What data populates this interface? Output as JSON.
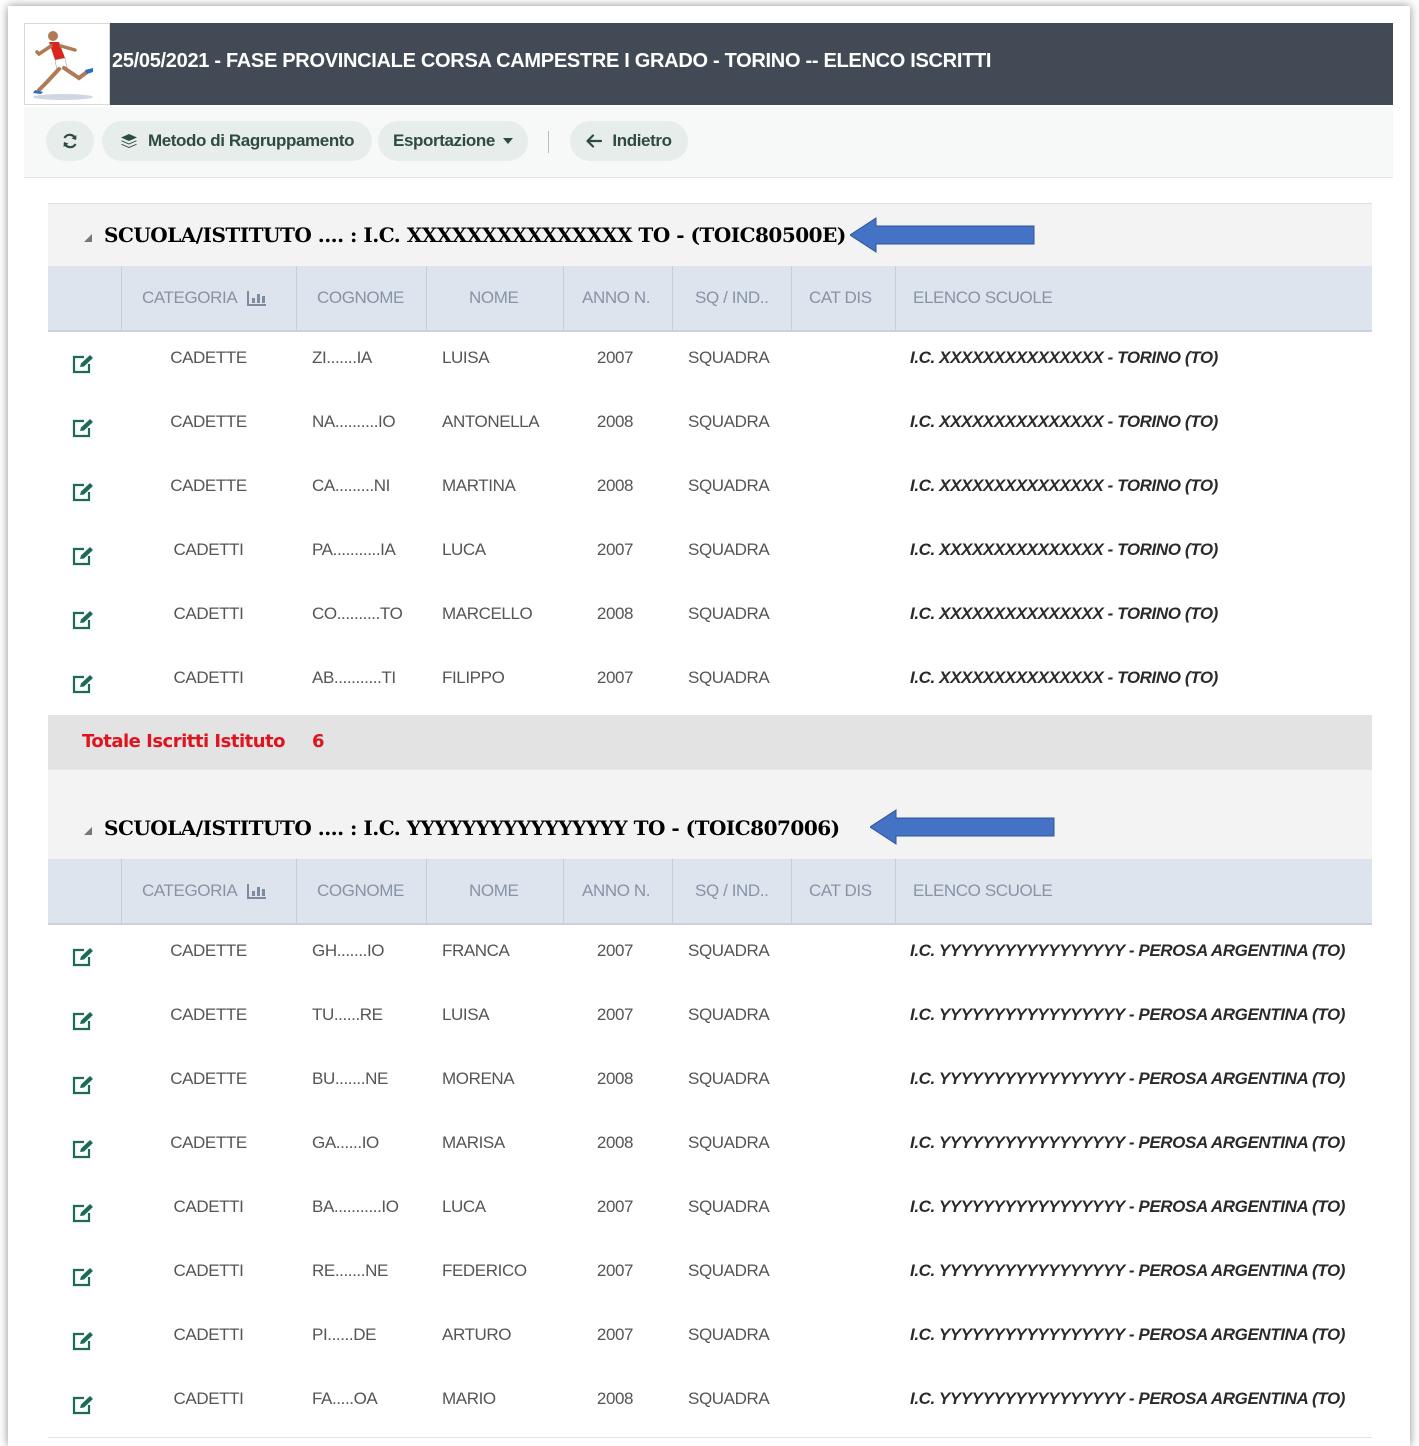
{
  "header": {
    "title": "25/05/2021 - FASE PROVINCIALE CORSA CAMPESTRE I GRADO - TORINO -- ELENCO ISCRITTI",
    "logo_icon": "runner-logo-icon"
  },
  "toolbar": {
    "refresh_icon": "refresh-icon",
    "grouping_label": "Metodo di Ragruppamento",
    "export_label": "Esportazione",
    "back_label": "Indietro"
  },
  "columns": {
    "categoria": "CATEGORIA",
    "cognome": "COGNOME",
    "nome": "NOME",
    "anno": "ANNO N.",
    "sq": "SQ / IND..",
    "catdis": "CAT DIS",
    "scuole": "ELENCO SCUOLE"
  },
  "colors": {
    "title_bar": "#424a55",
    "arrow": "#4472c4",
    "total_text": "#e0141f",
    "edit_icon": "#1c6b59"
  },
  "groups": [
    {
      "header": "SCUOLA/ISTITUTO .... : I.C. XXXXXXXXXXXXXXX TO - (TOIC80500E)",
      "rows": [
        {
          "categoria": "CADETTE",
          "cognome": "ZI.......IA",
          "nome": "LUISA",
          "anno": "2007",
          "sq": "SQUADRA",
          "catdis": "",
          "scuola": "I.C. XXXXXXXXXXXXXXX - TORINO (TO)"
        },
        {
          "categoria": "CADETTE",
          "cognome": "NA..........IO",
          "nome": "ANTONELLA",
          "anno": "2008",
          "sq": "SQUADRA",
          "catdis": "",
          "scuola": "I.C. XXXXXXXXXXXXXXX - TORINO (TO)"
        },
        {
          "categoria": "CADETTE",
          "cognome": "CA.........NI",
          "nome": "MARTINA",
          "anno": "2008",
          "sq": "SQUADRA",
          "catdis": "",
          "scuola": "I.C. XXXXXXXXXXXXXXX - TORINO (TO)"
        },
        {
          "categoria": "CADETTI",
          "cognome": "PA...........IA",
          "nome": "LUCA",
          "anno": "2007",
          "sq": "SQUADRA",
          "catdis": "",
          "scuola": "I.C. XXXXXXXXXXXXXXX - TORINO (TO)"
        },
        {
          "categoria": "CADETTI",
          "cognome": "CO..........TO",
          "nome": "MARCELLO",
          "anno": "2008",
          "sq": "SQUADRA",
          "catdis": "",
          "scuola": "I.C. XXXXXXXXXXXXXXX - TORINO (TO)"
        },
        {
          "categoria": "CADETTI",
          "cognome": "AB...........TI",
          "nome": "FILIPPO",
          "anno": "2007",
          "sq": "SQUADRA",
          "catdis": "",
          "scuola": "I.C. XXXXXXXXXXXXXXX - TORINO (TO)"
        }
      ],
      "total_label": "Totale Iscritti Istituto",
      "total_value": "6"
    },
    {
      "header": "SCUOLA/ISTITUTO .... : I.C. YYYYYYYYYYYYYYYY TO - (TOIC807006)",
      "rows": [
        {
          "categoria": "CADETTE",
          "cognome": "GH.......IO",
          "nome": "FRANCA",
          "anno": "2007",
          "sq": "SQUADRA",
          "catdis": "",
          "scuola": "I.C. YYYYYYYYYYYYYYYYY - PEROSA ARGENTINA (TO)"
        },
        {
          "categoria": "CADETTE",
          "cognome": "TU......RE",
          "nome": "LUISA",
          "anno": "2007",
          "sq": "SQUADRA",
          "catdis": "",
          "scuola": "I.C. YYYYYYYYYYYYYYYYY - PEROSA ARGENTINA (TO)"
        },
        {
          "categoria": "CADETTE",
          "cognome": "BU.......NE",
          "nome": "MORENA",
          "anno": "2008",
          "sq": "SQUADRA",
          "catdis": "",
          "scuola": "I.C. YYYYYYYYYYYYYYYYY - PEROSA ARGENTINA (TO)"
        },
        {
          "categoria": "CADETTE",
          "cognome": "GA......IO",
          "nome": "MARISA",
          "anno": "2008",
          "sq": "SQUADRA",
          "catdis": "",
          "scuola": "I.C. YYYYYYYYYYYYYYYYY - PEROSA ARGENTINA (TO)"
        },
        {
          "categoria": "CADETTI",
          "cognome": "BA...........IO",
          "nome": "LUCA",
          "anno": "2007",
          "sq": "SQUADRA",
          "catdis": "",
          "scuola": "I.C. YYYYYYYYYYYYYYYYY - PEROSA ARGENTINA (TO)"
        },
        {
          "categoria": "CADETTI",
          "cognome": "RE.......NE",
          "nome": "FEDERICO",
          "anno": "2007",
          "sq": "SQUADRA",
          "catdis": "",
          "scuola": "I.C. YYYYYYYYYYYYYYYYY - PEROSA ARGENTINA (TO)"
        },
        {
          "categoria": "CADETTI",
          "cognome": "PI......DE",
          "nome": "ARTURO",
          "anno": "2007",
          "sq": "SQUADRA",
          "catdis": "",
          "scuola": "I.C. YYYYYYYYYYYYYYYYY - PEROSA ARGENTINA (TO)"
        },
        {
          "categoria": "CADETTI",
          "cognome": "FA.....OA",
          "nome": "MARIO",
          "anno": "2008",
          "sq": "SQUADRA",
          "catdis": "",
          "scuola": "I.C. YYYYYYYYYYYYYYYYY - PEROSA ARGENTINA (TO)"
        }
      ]
    }
  ]
}
